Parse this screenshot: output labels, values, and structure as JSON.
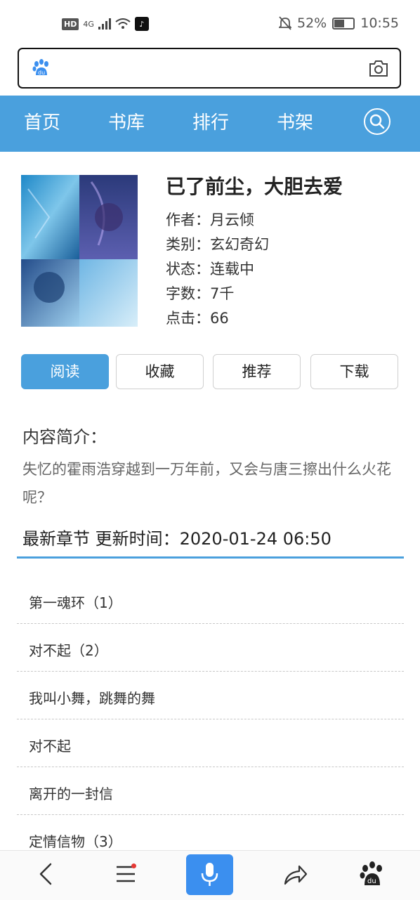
{
  "status_bar": {
    "hd": "HD",
    "signal": "4G",
    "battery": "52%",
    "time": "10:55"
  },
  "nav": {
    "items": [
      "首页",
      "书库",
      "排行",
      "书架"
    ]
  },
  "book": {
    "title": "已了前尘，大胆去爱",
    "author": "作者：月云倾",
    "category": "类别：玄幻奇幻",
    "status": "状态：连载中",
    "word_count": "字数：7千",
    "clicks": "点击：66"
  },
  "actions": {
    "read": "阅读",
    "collect": "收藏",
    "recommend": "推荐",
    "download": "下载"
  },
  "intro": {
    "heading": "内容简介：",
    "text": "失忆的霍雨浩穿越到一万年前，又会与唐三擦出什么火花呢？"
  },
  "latest": {
    "heading": "最新章节 更新时间：2020-01-24 06:50"
  },
  "chapters": [
    "第一魂环（1）",
    "对不起（2）",
    "我叫小舞，跳舞的舞",
    "对不起",
    "离开的一封信",
    "定情信物（3）"
  ],
  "colors": {
    "accent": "#4aa0dd",
    "mic": "#3b8fef"
  }
}
